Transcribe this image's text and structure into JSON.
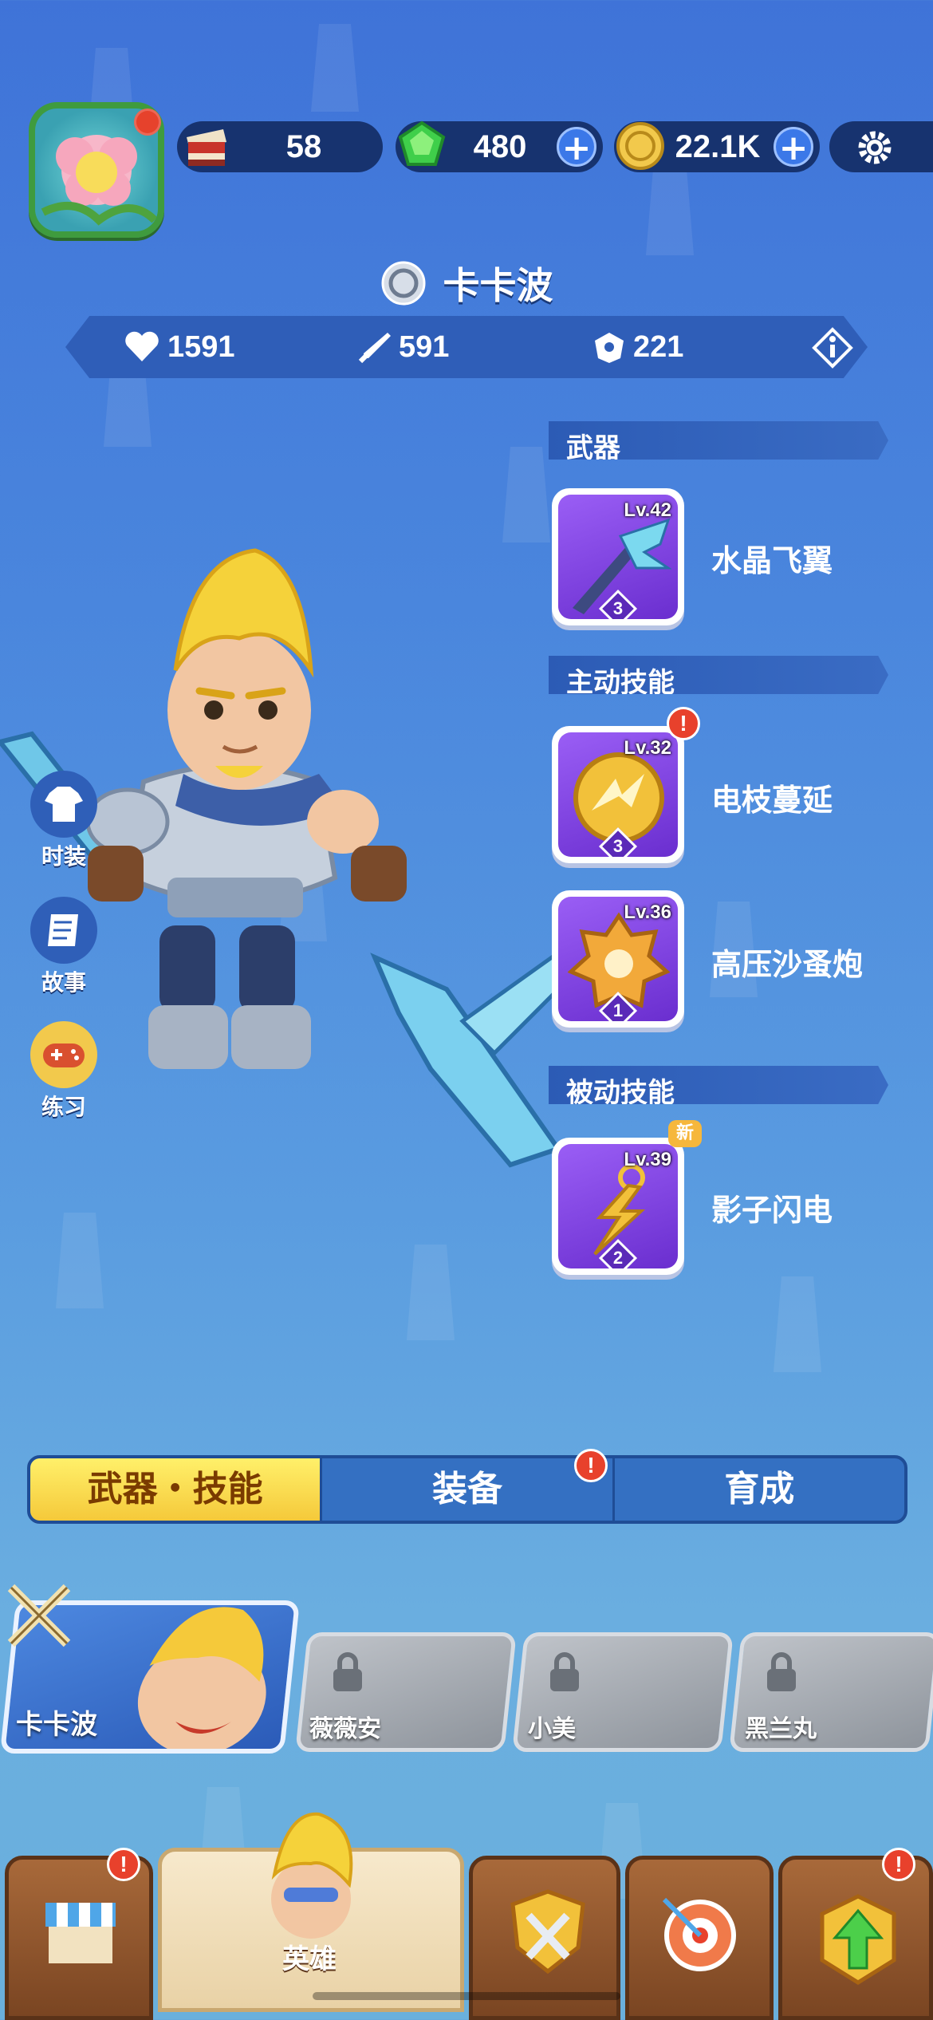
{
  "resources": {
    "stamina": "58",
    "gems": "480",
    "coins": "22.1K"
  },
  "hero": {
    "name": "卡卡波",
    "stats": {
      "health": "1591",
      "attack": "591",
      "defense": "221"
    }
  },
  "sections": {
    "weapon": "武器",
    "active_skill": "主动技能",
    "passive_skill": "被动技能"
  },
  "skills": [
    {
      "name": "水晶飞翼",
      "level": "Lv.42",
      "rank": "3"
    },
    {
      "name": "电枝蔓延",
      "level": "Lv.32",
      "rank": "3",
      "alert": "!"
    },
    {
      "name": "高压沙蚤炮",
      "level": "Lv.36",
      "rank": "1"
    },
    {
      "name": "影子闪电",
      "level": "Lv.39",
      "rank": "2",
      "badge": "新"
    }
  ],
  "side_menu": [
    {
      "label": "时装"
    },
    {
      "label": "故事"
    },
    {
      "label": "练习"
    }
  ],
  "tabs": [
    {
      "label": "武器・技能",
      "active": true
    },
    {
      "label": "装备",
      "alert": "!"
    },
    {
      "label": "育成"
    }
  ],
  "roster": [
    {
      "name": "卡卡波",
      "selected": true
    },
    {
      "name": "薇薇安",
      "locked": true
    },
    {
      "name": "小美",
      "locked": true
    },
    {
      "name": "黑兰丸",
      "locked": true
    }
  ],
  "bottom_nav": [
    {
      "id": "shop",
      "alert": "!"
    },
    {
      "id": "hero",
      "label": "英雄",
      "active": true
    },
    {
      "id": "battle"
    },
    {
      "id": "event"
    },
    {
      "id": "upgrade",
      "alert": "!"
    }
  ],
  "colors": {
    "accent_yellow": "#f5c93a",
    "alert_red": "#e8412c",
    "dark_navy": "#17336f"
  }
}
